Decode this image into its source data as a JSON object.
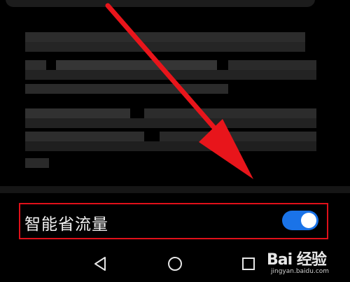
{
  "setting": {
    "label": "智能省流量",
    "enabled": true
  },
  "navigation": {
    "back_icon": "back-triangle-icon",
    "home_icon": "home-circle-icon",
    "recents_icon": "recents-square-icon"
  },
  "watermark": {
    "brand": "Bai 经验",
    "site": "jingyan.baidu.com"
  },
  "colors": {
    "background": "#000000",
    "toggle_on": "#1a73e8",
    "highlight_box": "#e0101a",
    "arrow": "#e8151b"
  }
}
